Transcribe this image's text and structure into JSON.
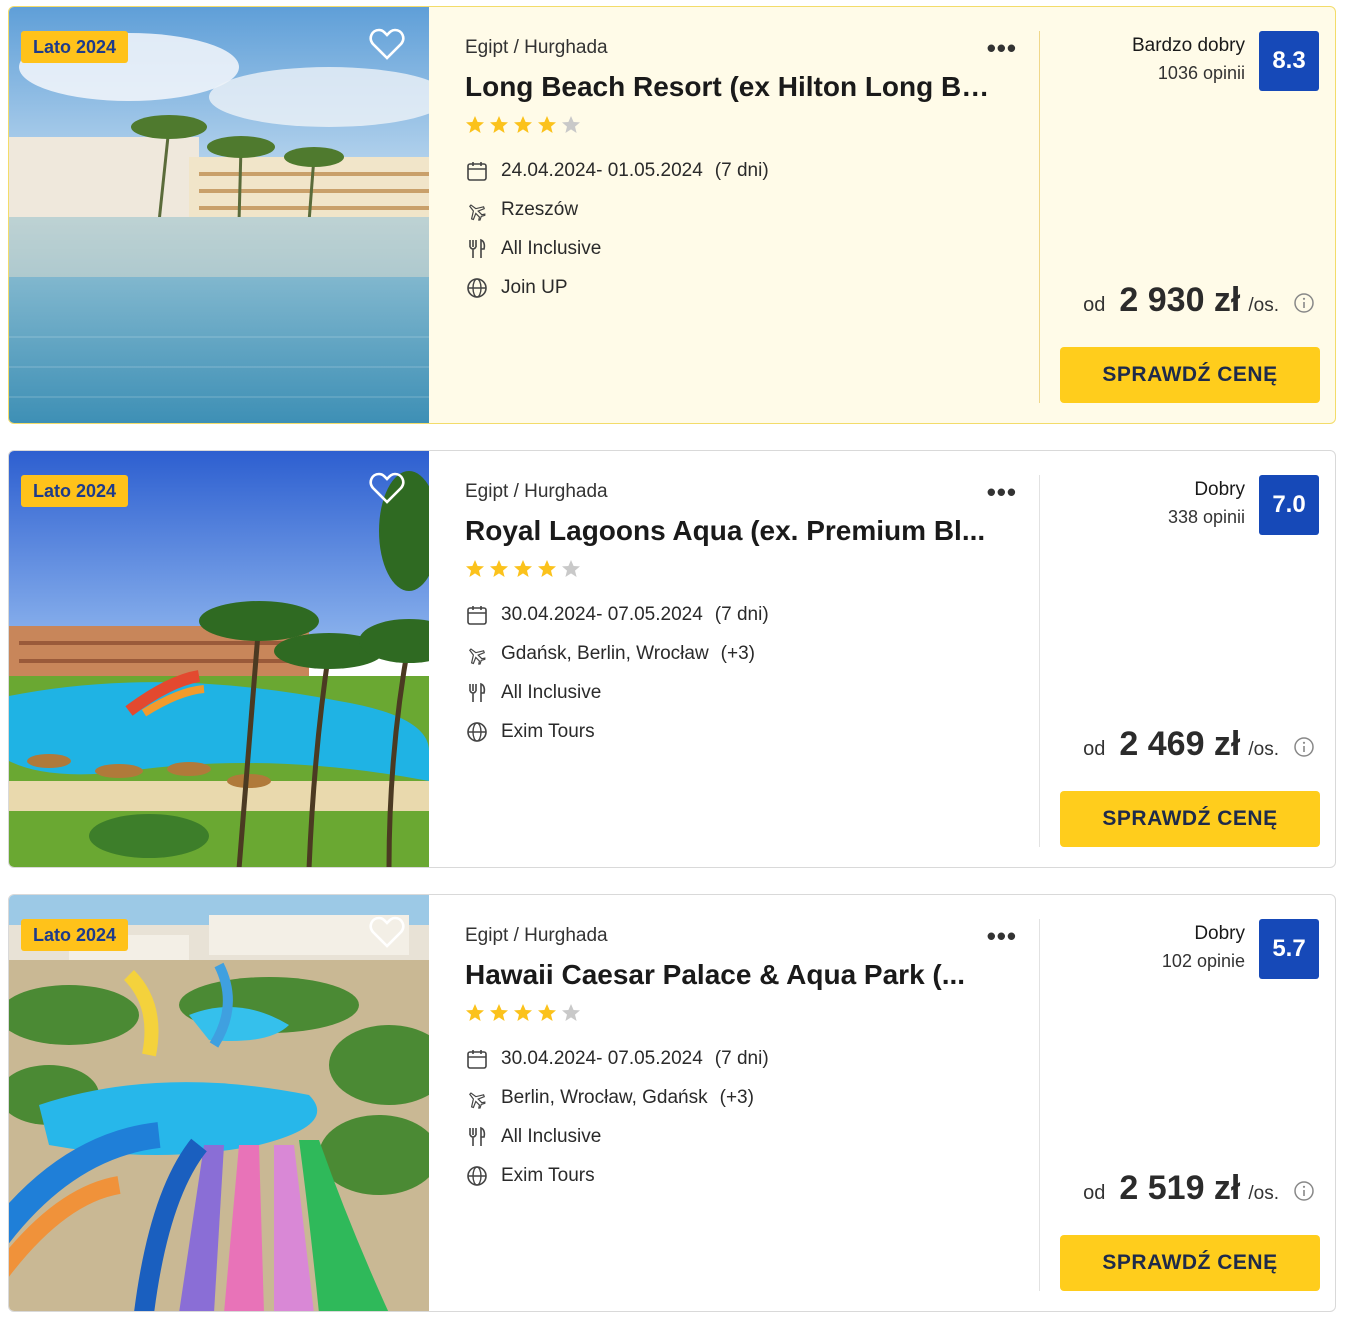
{
  "offers": [
    {
      "badge": "Lato 2024",
      "location": "Egipt / Hurghada",
      "title": "Long Beach Resort (ex Hilton Long Be...",
      "stars": 4,
      "dates": "24.04.2024- 01.05.2024",
      "duration": "(7 dni)",
      "departure": "Rzeszów",
      "departure_extra": "",
      "board": "All Inclusive",
      "operator": "Join UP",
      "rating_label": "Bardzo dobry",
      "rating_count": "1036 opinii",
      "score": "8.3",
      "price_prefix": "od",
      "price": "2 930 zł",
      "price_unit": "/os.",
      "cta": "SPRAWDŹ CENĘ"
    },
    {
      "badge": "Lato 2024",
      "location": "Egipt / Hurghada",
      "title": "Royal Lagoons Aqua (ex. Premium Bl...",
      "stars": 4,
      "dates": "30.04.2024- 07.05.2024",
      "duration": "(7 dni)",
      "departure": "Gdańsk, Berlin, Wrocław",
      "departure_extra": "(+3)",
      "board": "All Inclusive",
      "operator": "Exim Tours",
      "rating_label": "Dobry",
      "rating_count": "338 opinii",
      "score": "7.0",
      "price_prefix": "od",
      "price": "2 469 zł",
      "price_unit": "/os.",
      "cta": "SPRAWDŹ CENĘ"
    },
    {
      "badge": "Lato 2024",
      "location": "Egipt / Hurghada",
      "title": "Hawaii Caesar Palace & Aqua Park (...",
      "stars": 4,
      "dates": "30.04.2024- 07.05.2024",
      "duration": "(7 dni)",
      "departure": "Berlin, Wrocław, Gdańsk",
      "departure_extra": "(+3)",
      "board": "All Inclusive",
      "operator": "Exim Tours",
      "rating_label": "Dobry",
      "rating_count": "102 opinie",
      "score": "5.7",
      "price_prefix": "od",
      "price": "2 519 zł",
      "price_unit": "/os.",
      "cta": "SPRAWDŹ CENĘ"
    }
  ],
  "icons": {
    "favorite": "heart-icon",
    "more": "more-dots-icon",
    "date": "calendar-icon",
    "departure": "plane-icon",
    "board": "cutlery-icon",
    "operator": "globe-icon",
    "info": "info-icon",
    "star": "star-icon"
  },
  "colors": {
    "badge_bg": "#ffc21a",
    "badge_text": "#1e3b8a",
    "score_bg": "#1649b8",
    "cta_bg": "#ffcd1c",
    "highlight_bg": "#fffbe8",
    "star_filled": "#fbc21c",
    "star_empty": "#c9c9c9"
  }
}
